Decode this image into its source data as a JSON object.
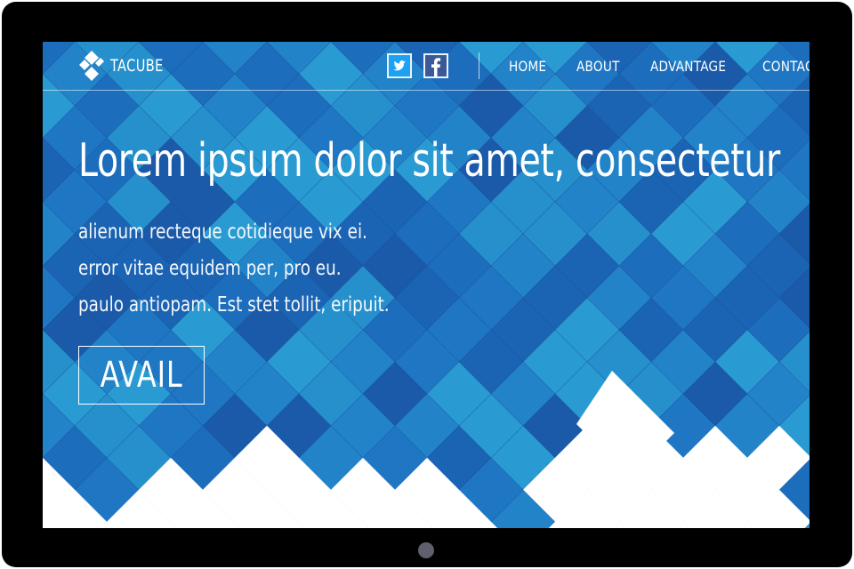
{
  "brand": {
    "name": "TACUBE"
  },
  "social": [
    {
      "icon": "twitter-icon"
    },
    {
      "icon": "facebook-icon"
    }
  ],
  "nav": {
    "items": [
      {
        "label": "HOME"
      },
      {
        "label": "ABOUT"
      },
      {
        "label": "ADVANTAGE"
      },
      {
        "label": "CONTACT"
      }
    ]
  },
  "hero": {
    "headline": "Lorem ipsum dolor sit amet, consectetur",
    "lines": [
      "alienum recteque cotidieque vix ei.",
      "error vitae equidem per, pro eu.",
      "paulo antiopam. Est stet tollit, eripuit."
    ],
    "cta_label": "AVAIL"
  },
  "colors": {
    "background_blue": "#1e79c2",
    "tile_dark": "#1a5fb0",
    "tile_light": "#2a97cf",
    "device_frame": "#000000",
    "text": "#ffffff"
  }
}
